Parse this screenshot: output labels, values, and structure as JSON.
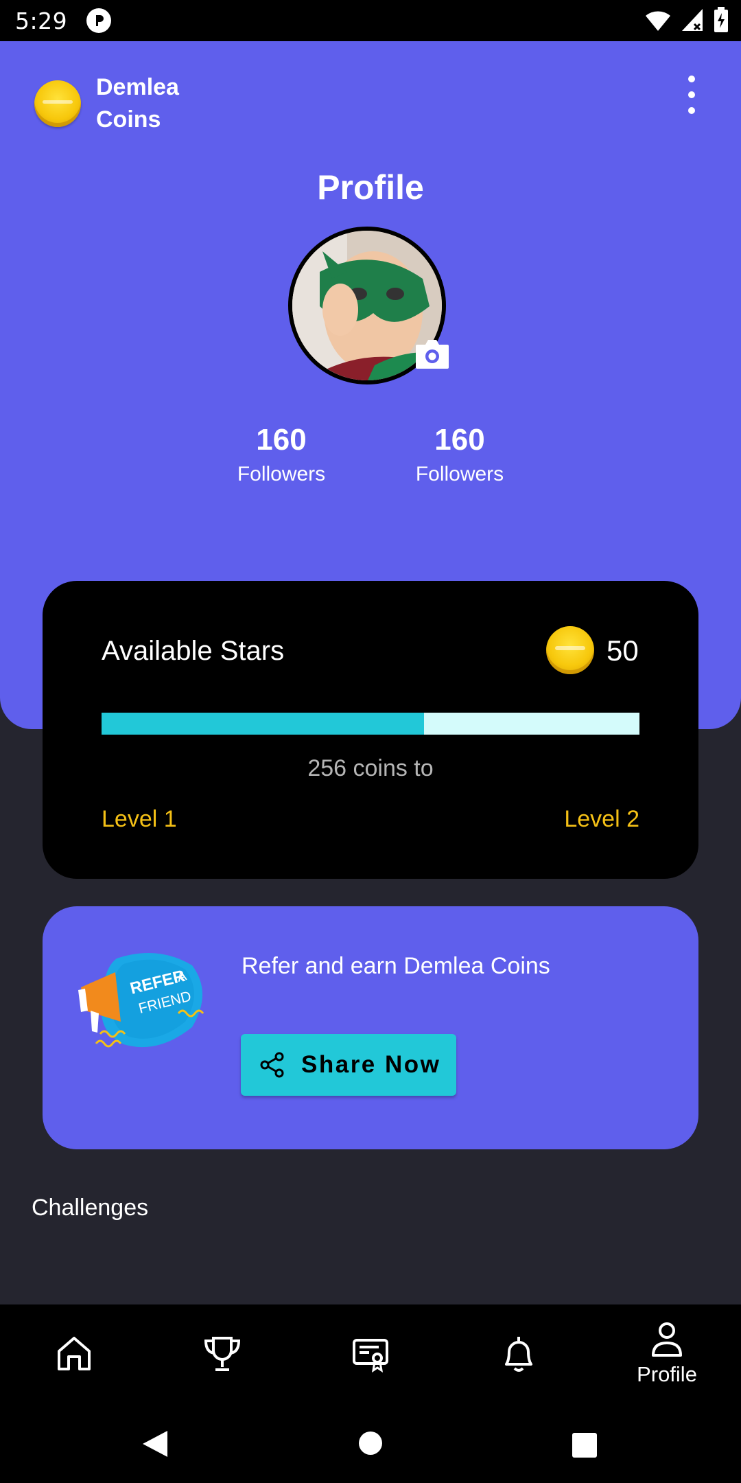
{
  "status_bar": {
    "time": "5:29"
  },
  "header": {
    "brand_name": "Demlea Coins",
    "page_title": "Profile"
  },
  "profile": {
    "stats": [
      {
        "value": "160",
        "label": "Followers"
      },
      {
        "value": "160",
        "label": "Followers"
      }
    ]
  },
  "stars_card": {
    "title": "Available Stars",
    "value": "50",
    "progress_fraction": 0.6,
    "caption": "256 coins to",
    "level_from": "Level 1",
    "level_to": "Level 2"
  },
  "refer_card": {
    "text": "Refer and earn Demlea Coins",
    "button_label": "Share Now",
    "art_text_1": "REFER",
    "art_text_2": "A",
    "art_text_3": "FRIEND"
  },
  "section": {
    "title": "Challenges"
  },
  "bottom_nav": {
    "items": [
      {
        "icon": "home-icon",
        "label": ""
      },
      {
        "icon": "trophy-icon",
        "label": ""
      },
      {
        "icon": "certificate-icon",
        "label": ""
      },
      {
        "icon": "bell-icon",
        "label": ""
      },
      {
        "icon": "person-icon",
        "label": "Profile"
      }
    ]
  },
  "colors": {
    "primary": "#5f5fec",
    "accent": "#22c8d8",
    "gold": "#f5c116",
    "background": "#25252f"
  }
}
